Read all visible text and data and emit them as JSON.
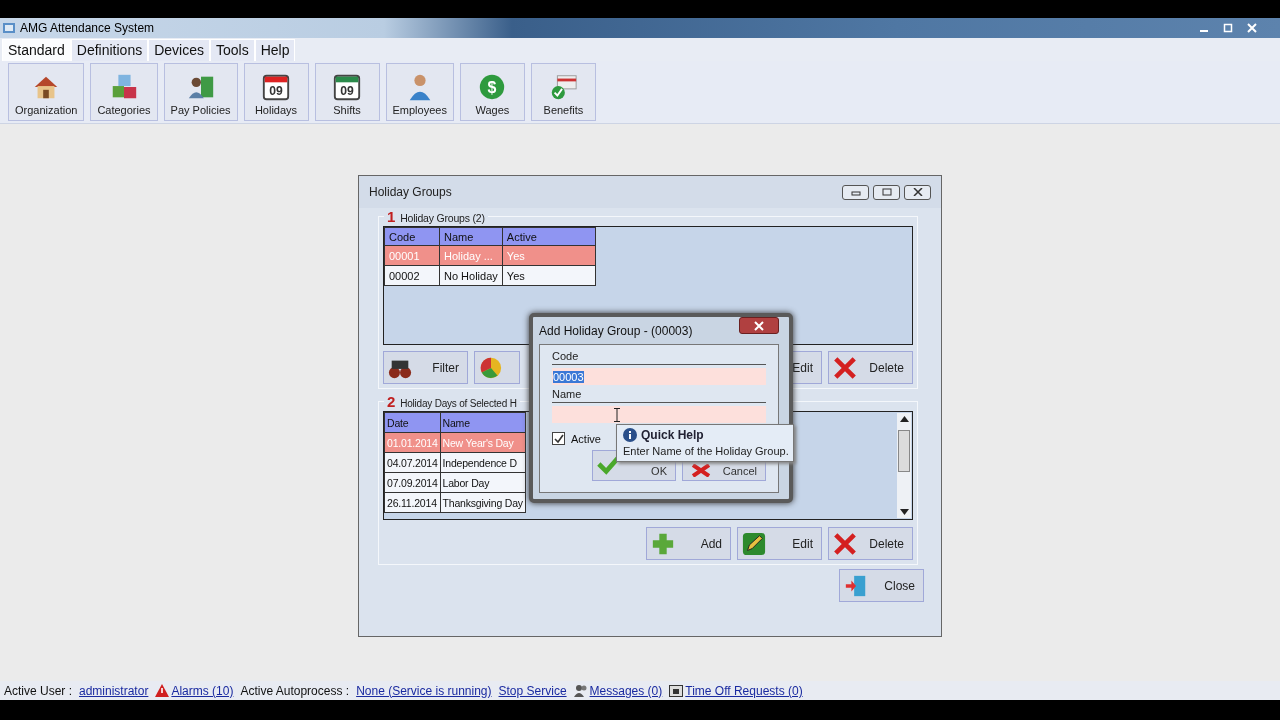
{
  "window": {
    "title": "AMG Attendance System"
  },
  "menu": [
    {
      "label": "Standard",
      "selected": true
    },
    {
      "label": "Definitions",
      "selected": false
    },
    {
      "label": "Devices",
      "selected": false
    },
    {
      "label": "Tools",
      "selected": false
    },
    {
      "label": "Help",
      "selected": false
    }
  ],
  "toolbar": [
    {
      "kind": "house",
      "label": "Organization"
    },
    {
      "kind": "cubes",
      "label": "Categories"
    },
    {
      "kind": "person-book",
      "label": "Pay Policies"
    },
    {
      "kind": "calendar-red",
      "label": "Holidays",
      "day": "09"
    },
    {
      "kind": "calendar-green",
      "label": "Shifts",
      "day": "09"
    },
    {
      "kind": "person",
      "label": "Employees"
    },
    {
      "kind": "dollar",
      "label": "Wages",
      "symbol": "$"
    },
    {
      "kind": "card-check",
      "label": "Benefits"
    }
  ],
  "holiday_groups_window": {
    "title": "Holiday Groups",
    "groups_section": {
      "number": "1",
      "title": "Holiday Groups (2)",
      "columns": [
        "Code",
        "Name",
        "Active"
      ],
      "rows": [
        {
          "cells": [
            "00001",
            "Holiday ...",
            "Yes"
          ],
          "selected": true
        },
        {
          "cells": [
            "00002",
            "No Holiday",
            "Yes"
          ],
          "selected": false
        }
      ],
      "buttons": [
        {
          "kind": "filter",
          "label": "Filter"
        },
        {
          "kind": "chart"
        },
        {
          "kind": "edit-hidden",
          "label": "Edit"
        },
        {
          "kind": "delete",
          "label": "Delete"
        }
      ]
    },
    "days_section": {
      "number": "2",
      "title": "Holiday Days of Selected H",
      "columns": [
        "Date",
        "Name"
      ],
      "rows": [
        {
          "cells": [
            "01.01.2014",
            "New Year's Day"
          ],
          "selected": true
        },
        {
          "cells": [
            "04.07.2014",
            "Independence D"
          ],
          "selected": false
        },
        {
          "cells": [
            "07.09.2014",
            "Labor Day"
          ],
          "selected": false
        },
        {
          "cells": [
            "26.11.2014",
            "Thanksgiving Day"
          ],
          "selected": false
        }
      ],
      "buttons": [
        {
          "kind": "add",
          "label": "Add"
        },
        {
          "kind": "edit",
          "label": "Edit"
        },
        {
          "kind": "delete",
          "label": "Delete"
        }
      ]
    },
    "close_button": "Close"
  },
  "dialog": {
    "title": "Add Holiday Group - (00003)",
    "code_label": "Code",
    "code_value": "00003",
    "name_label": "Name",
    "active_label": "Active",
    "active_checked": true,
    "ok": "OK",
    "cancel": "Cancel"
  },
  "tooltip": {
    "title": "Quick Help",
    "text": "Enter Name of the Holiday Group."
  },
  "status_bar": [
    {
      "kind": "label",
      "text": "Active User :"
    },
    {
      "kind": "link",
      "text": "administrator"
    },
    {
      "kind": "alarm-link",
      "text": "Alarms (10)"
    },
    {
      "kind": "label",
      "text": "Active Autoprocess :"
    },
    {
      "kind": "link",
      "text": "None (Service is running)"
    },
    {
      "kind": "link",
      "text": "Stop Service"
    },
    {
      "kind": "messages-link",
      "text": "Messages (0)"
    },
    {
      "kind": "requests-link",
      "text": "Time Off Requests (0)"
    }
  ]
}
